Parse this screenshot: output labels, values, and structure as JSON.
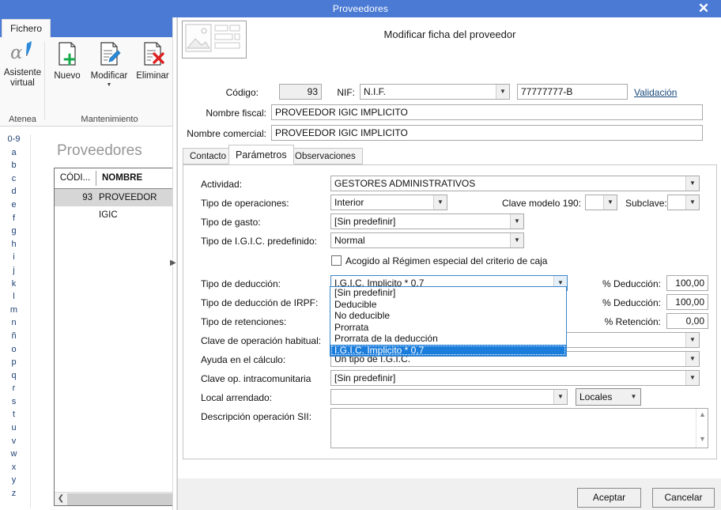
{
  "window": {
    "title": "Proveedores",
    "close_label": "✕"
  },
  "ribbon": {
    "tab_label": "Fichero",
    "groups": [
      {
        "label": "Atenea"
      },
      {
        "label": "Mantenimiento"
      }
    ],
    "buttons": {
      "assistant": {
        "line1": "Asistente",
        "line2": "virtual",
        "icon": "alpha-pen-icon"
      },
      "nuevo": {
        "label": "Nuevo",
        "icon": "new-document-icon"
      },
      "modificar": {
        "label": "Modificar",
        "icon": "edit-document-icon"
      },
      "eliminar": {
        "label": "Eliminar",
        "icon": "delete-document-icon"
      }
    }
  },
  "alphabet": [
    "0-9",
    "a",
    "b",
    "c",
    "d",
    "e",
    "f",
    "g",
    "h",
    "i",
    "j",
    "k",
    "l",
    "m",
    "n",
    "ñ",
    "o",
    "p",
    "q",
    "r",
    "s",
    "t",
    "u",
    "v",
    "w",
    "x",
    "y",
    "z"
  ],
  "list": {
    "title": "Proveedores",
    "columns": [
      "CÓDI...",
      "NOMBRE FISCAL"
    ],
    "rows": [
      {
        "codigo": "93",
        "nombre": "PROVEEDOR IGIC"
      }
    ],
    "scroll_left_icon": "chevron-left-icon"
  },
  "dialog": {
    "heading": "Modificar ficha del proveedor",
    "thumbnail_icon": "image-placeholder-icon",
    "fields": {
      "codigo_label": "Código:",
      "codigo_value": "93",
      "nif_label": "NIF:",
      "nif_type_value": "N.I.F.",
      "nif_value": "77777777-B",
      "validacion_link": "Validación",
      "nombre_fiscal_label": "Nombre fiscal:",
      "nombre_fiscal_value": "PROVEEDOR IGIC IMPLICITO",
      "nombre_comercial_label": "Nombre comercial:",
      "nombre_comercial_value": "PROVEEDOR IGIC IMPLICITO"
    },
    "tabs": [
      {
        "label": "Contacto",
        "active": false
      },
      {
        "label": "Parámetros",
        "active": true
      },
      {
        "label": "Observaciones",
        "active": false
      }
    ],
    "parametros": {
      "actividad_label": "Actividad:",
      "actividad_value": "GESTORES ADMINISTRATIVOS",
      "tipo_operaciones_label": "Tipo de operaciones:",
      "tipo_operaciones_value": "Interior",
      "clave_modelo_label": "Clave modelo 190:",
      "clave_modelo_value": "",
      "subclave_label": "Subclave:",
      "subclave_value": "",
      "tipo_gasto_label": "Tipo de gasto:",
      "tipo_gasto_value": "[Sin predefinir]",
      "tipo_igic_label": "Tipo de I.G.I.C. predefinido:",
      "tipo_igic_value": "Normal",
      "criterio_caja_label": "Acogido al Régimen especial del criterio de caja",
      "criterio_caja_checked": false,
      "tipo_deduccion_label": "Tipo de deducción:",
      "tipo_deduccion_value": "I.G.I.C. Implicito * 0,7",
      "pct_deduccion_label": "% Deducción:",
      "pct_deduccion_value": "100,00",
      "tipo_deduccion_irpf_label": "Tipo de deducción de IRPF:",
      "pct_deduccion2_label": "% Deducción:",
      "pct_deduccion2_value": "100,00",
      "tipo_retenciones_label": "Tipo de retenciones:",
      "pct_retencion_label": "% Retención:",
      "pct_retencion_value": "0,00",
      "clave_operacion_label": "Clave de operación habitual:",
      "clave_operacion_value": "",
      "ayuda_calculo_label": "Ayuda en el cálculo:",
      "ayuda_calculo_value": "Un tipo de I.G.I.C.",
      "clave_intra_label": "Clave op. intracomunitaria",
      "clave_intra_value": "[Sin predefinir]",
      "local_arrendado_label": "Local arrendado:",
      "local_arrendado_value": "",
      "locales_button_label": "Locales",
      "descripcion_sii_label": "Descripción operación SII:",
      "descripcion_sii_value": ""
    },
    "dropdown_open": {
      "options": [
        "[Sin predefinir]",
        "Deducible",
        "No deducible",
        "Prorrata",
        "Prorrata de la deducción",
        "I.G.I.C. Implicito * 0,7"
      ],
      "selected_index": 5
    },
    "buttons": {
      "accept": "Aceptar",
      "cancel": "Cancelar"
    }
  },
  "colors": {
    "titlebar": "#4a7ad4",
    "selection": "#1a7ddc",
    "row_selected": "#d6d6d6",
    "dialog_bg": "#f0f0f0"
  }
}
